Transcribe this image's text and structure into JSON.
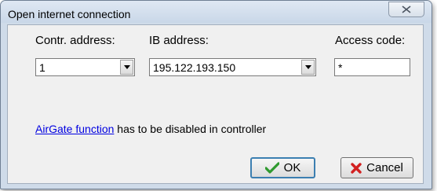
{
  "window": {
    "title": "Open internet connection"
  },
  "labels": {
    "controller_address": "Contr. address:",
    "ib_address": "IB address:",
    "access_code": "Access code:"
  },
  "fields": {
    "controller_address_value": "1",
    "ib_address_value": "195.122.193.150",
    "access_code_value": "*"
  },
  "note": {
    "link_text": "AirGate function",
    "rest_text": "has to be disabled in controller"
  },
  "buttons": {
    "ok_label": "OK",
    "cancel_label": "Cancel"
  },
  "icons": {
    "close": "close-x-icon",
    "dropdown": "chevron-down-icon",
    "ok": "checkmark-icon",
    "cancel": "red-x-icon"
  },
  "colors": {
    "link": "#0000e0",
    "ok_check": "#2f9a2f",
    "cancel_x": "#d22020"
  }
}
